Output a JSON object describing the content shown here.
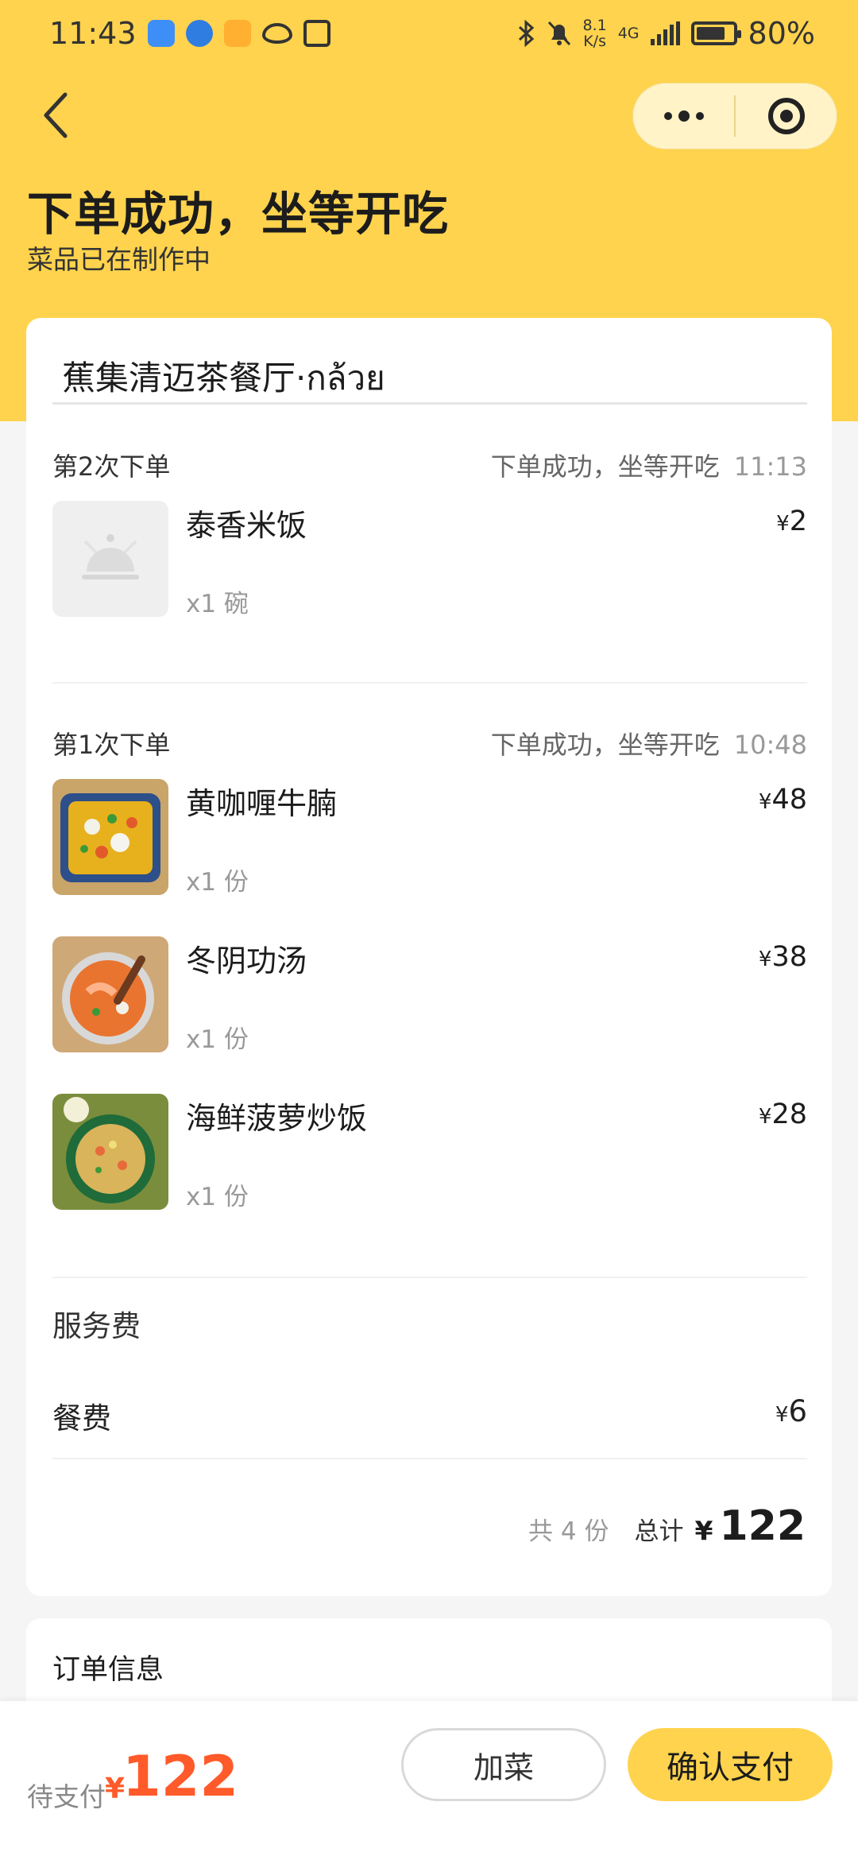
{
  "status_bar": {
    "time": "11:43",
    "net_speed_value": "8.1",
    "net_speed_unit": "K/s",
    "network": "4G",
    "battery": "80%",
    "battery_level": 0.8
  },
  "nav": {
    "more_icon": "more-dots-icon",
    "close_icon": "target-icon"
  },
  "header": {
    "title": "下单成功，坐等开吃",
    "subtitle": "菜品已在制作中"
  },
  "shop": {
    "name": "蕉集清迈茶餐厅·กล้วย"
  },
  "orders": [
    {
      "label": "第2次下单",
      "status": "下单成功，坐等开吃",
      "time": "11:13",
      "items": [
        {
          "name": "泰香米饭",
          "qty": "x1 碗",
          "price_symbol": "¥",
          "price": "2",
          "image": "placeholder-dish-icon"
        }
      ]
    },
    {
      "label": "第1次下单",
      "status": "下单成功，坐等开吃",
      "time": "10:48",
      "items": [
        {
          "name": "黄咖喱牛腩",
          "qty": "x1 份",
          "price_symbol": "¥",
          "price": "48",
          "image": "curry-photo"
        },
        {
          "name": "冬阴功汤",
          "qty": "x1 份",
          "price_symbol": "¥",
          "price": "38",
          "image": "tomyum-photo"
        },
        {
          "name": "海鲜菠萝炒饭",
          "qty": "x1 份",
          "price_symbol": "¥",
          "price": "28",
          "image": "fried-rice-photo"
        }
      ]
    }
  ],
  "fees": {
    "title": "服务费",
    "rows": [
      {
        "label": "餐费",
        "symbol": "¥",
        "amount": "6"
      }
    ]
  },
  "summary": {
    "count": "共 4 份",
    "total_label": "总计",
    "symbol": "¥",
    "total": "122"
  },
  "order_info": {
    "title": "订单信息"
  },
  "bottom": {
    "pay_label": "待支付",
    "symbol": "¥",
    "amount": "122",
    "add_label": "加菜",
    "confirm_label": "确认支付"
  },
  "colors": {
    "accent": "#ffd34d",
    "price": "#ff5a2a"
  }
}
